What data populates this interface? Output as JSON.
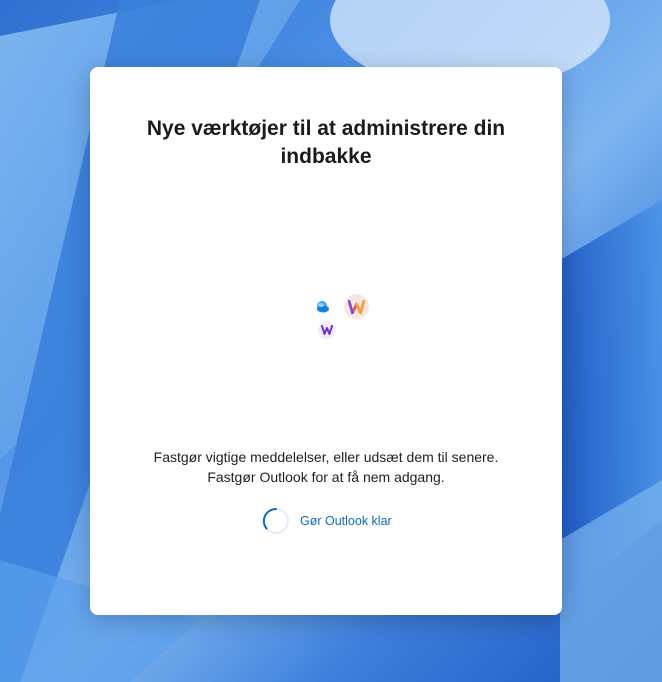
{
  "dialog": {
    "title": "Nye værktøjer til at administrere din indbakke",
    "description_line1": "Fastgør vigtige meddelelser, eller udsæt dem til senere.",
    "description_line2": "Fastgør Outlook for at få nem adgang.",
    "status_text": "Gør Outlook klar",
    "illustration_icons": [
      "weather-icon",
      "loop-icon",
      "viva-icon"
    ]
  },
  "colors": {
    "accent": "#0f6cbd",
    "background_primary": "#2f6fd0",
    "dialog_background": "#ffffff"
  }
}
